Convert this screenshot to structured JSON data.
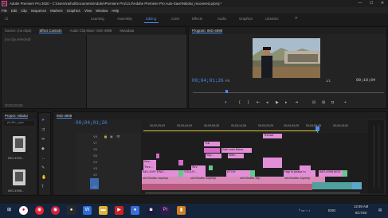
{
  "titlebar": {
    "icon": "Pr",
    "title": "Adobe Premiere Pro 2020 - C:\\Users\\raihul\\Documents\\Adobe\\Premiere Pro\\14.0\\Adobe Premiere Pro Auto-Save\\Nikolai_recovered.prproj *",
    "minimize": "—",
    "maximize": "☐",
    "close": "✕"
  },
  "menu": [
    "File",
    "Edit",
    "Clip",
    "Sequence",
    "Markers",
    "Graphics",
    "View",
    "Window",
    "Help"
  ],
  "workspaces": {
    "home_icon": "home-icon",
    "tabs": [
      "Learning",
      "Assembly",
      "Editing",
      "Color",
      "Effects",
      "Audio",
      "Graphics",
      "Libraries"
    ],
    "active": "Editing",
    "more": "»"
  },
  "source_panel": {
    "tabs": [
      "Source: (no clips)",
      "Effect Controls",
      "Audio Clip Mixer: IMG-4998",
      "Metadata"
    ],
    "active_tab": "Effect Controls",
    "empty_text": "(no clip selected)",
    "timecode": "00;00;00;00"
  },
  "program_panel": {
    "tab": "Program: IMG-4998",
    "timecode": "00;04;01;26",
    "fit": "Fit",
    "quality": "1/1",
    "duration": "00;10;04"
  },
  "project_panel": {
    "tab": "Project: Nikolai",
    "items": [
      {
        "name": "IMG-4999..."
      },
      {
        "name": "IMG-4998..."
      }
    ],
    "search_label": "ph-film_sync"
  },
  "timeline": {
    "tab": "IMG-4998",
    "timecode": "00;04;01;26",
    "ruler": [
      "00;02;29;29",
      "00;03;44;29",
      "00;03;59;28",
      "00;04;14;28",
      "00;04;29;29",
      "00;04;44;29",
      "00;04;59;28",
      "00;05;14;28",
      "00;04;15;00"
    ],
    "video_tracks": [
      "V8",
      "V7",
      "V6",
      "V5",
      "V4",
      "V3",
      "V2",
      "V1"
    ],
    "audio_tracks": [
      "A1",
      "A2"
    ],
    "clips": [
      {
        "label": "Thread",
        "row": "V8"
      },
      {
        "label": "Yuk",
        "row": "V6"
      },
      {
        "label": "Wah wah Bales",
        "row": "V5"
      },
      {
        "label": "Yup...",
        "row": "V4"
      },
      {
        "label": "Wah...",
        "row": "V4"
      },
      {
        "label": "Sev...",
        "row": "V3"
      },
      {
        "label": "Thre...",
        "row": "V2"
      },
      {
        "label": "Sev",
        "row": "V2"
      },
      {
        "label": "IMG-4997.MOV",
        "row": "V1"
      },
      {
        "label": "ENG...",
        "row": "V1"
      },
      {
        "label": "Y-5-4-R...",
        "row": "V1"
      },
      {
        "label": "ETGH",
        "row": "V1"
      },
      {
        "label": "Hap in phase fo",
        "row": "V1"
      },
      {
        "label": "IMG-4998.MOV",
        "row": "V1"
      },
      {
        "label": "ohhShuffer-biprimp",
        "row": "A1"
      },
      {
        "label": "ohhShuffer-biprimp",
        "row": "A1"
      },
      {
        "label": "ohhShuffer-bip...",
        "row": "A1"
      },
      {
        "label": "ohhShuffer-biprimp",
        "row": "A1"
      }
    ]
  },
  "taskbar": {
    "icons": [
      "windows-start-icon",
      "search-icon",
      "chrome-icon",
      "mail-icon",
      "android-icon",
      "word-icon",
      "files-icon",
      "premiere-icon",
      "stream-icon",
      "people-icon"
    ],
    "language": "ENG",
    "time": "12:59 AM",
    "date": "8/17/20"
  },
  "colors": {
    "accent": "#4a8df0",
    "clip_pink": "#e38fd8",
    "clip_green": "#5fc98a",
    "audio": "#4fa1a0"
  }
}
